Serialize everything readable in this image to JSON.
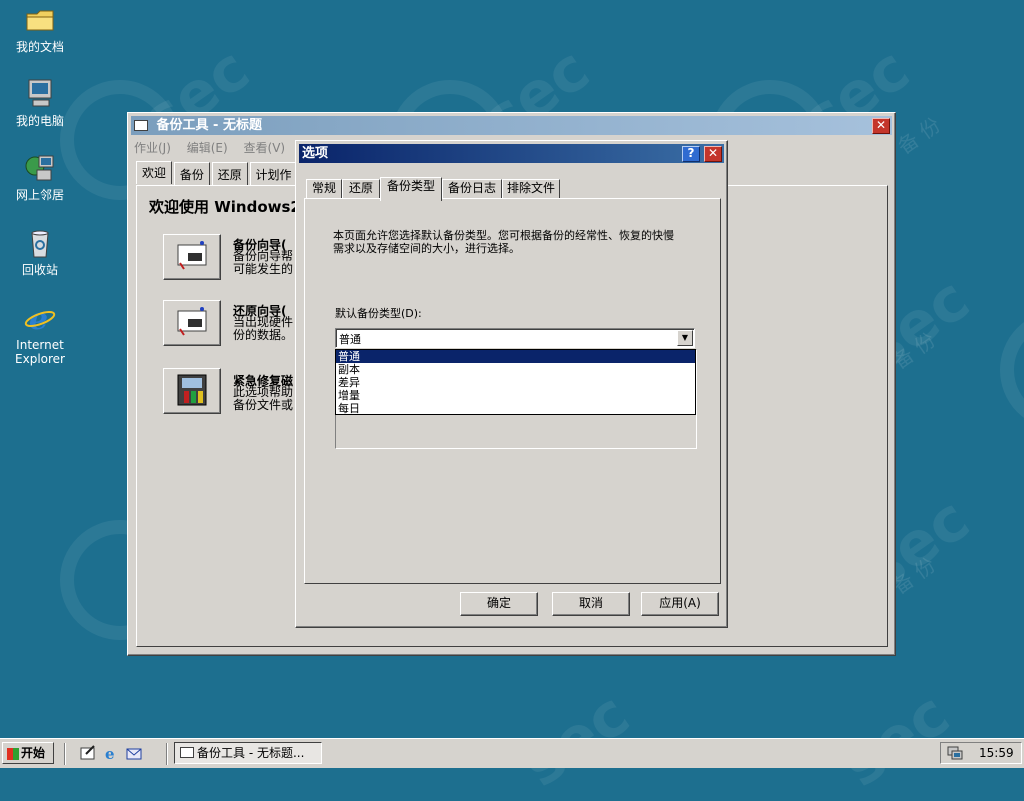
{
  "desktop": {
    "icons": [
      {
        "label": "我的文档"
      },
      {
        "label": "我的电脑"
      },
      {
        "label": "网上邻居"
      },
      {
        "label": "回收站"
      },
      {
        "label": "Internet Explorer"
      }
    ]
  },
  "backup_window": {
    "title": "备份工具 - 无标题",
    "menu": [
      "作业(J)",
      "编辑(E)",
      "查看(V)"
    ],
    "tabs": [
      "欢迎",
      "备份",
      "还原",
      "计划作"
    ],
    "selected_tab": "欢迎",
    "welcome_title": "欢迎使用 Windows2",
    "wizards": [
      {
        "title": "备份向导(",
        "desc": [
          "备份向导帮",
          "可能发生的"
        ]
      },
      {
        "title": "还原向导(",
        "desc": [
          "当出现硬件",
          "份的数据。"
        ]
      },
      {
        "title": "紧急修复磁",
        "desc": [
          "此选项帮助",
          "备份文件或"
        ]
      }
    ]
  },
  "options_dialog": {
    "title": "选项",
    "help_glyph": "?",
    "close_glyph": "✕",
    "tabs": [
      "常规",
      "还原",
      "备份类型",
      "备份日志",
      "排除文件"
    ],
    "selected_tab": "备份类型",
    "description": "本页面允许您选择默认备份类型。您可根据备份的经常性、恢复的快慢需求以及存储空间的大小，进行选择。",
    "default_type_label": "默认备份类型(D):",
    "combo_value": "普通",
    "dropdown_options": [
      "普通",
      "副本",
      "差异",
      "增量",
      "每日"
    ],
    "selected_option": "普通",
    "buttons": {
      "ok": "确定",
      "cancel": "取消",
      "apply": "应用(A)"
    }
  },
  "taskbar": {
    "start_label": "开始",
    "task_label": "备份工具 - 无标题...",
    "clock": "15:59"
  },
  "colors": {
    "desktop": "#1d6f8f",
    "active_title": "#0a246a",
    "selection": "#0a246a"
  }
}
